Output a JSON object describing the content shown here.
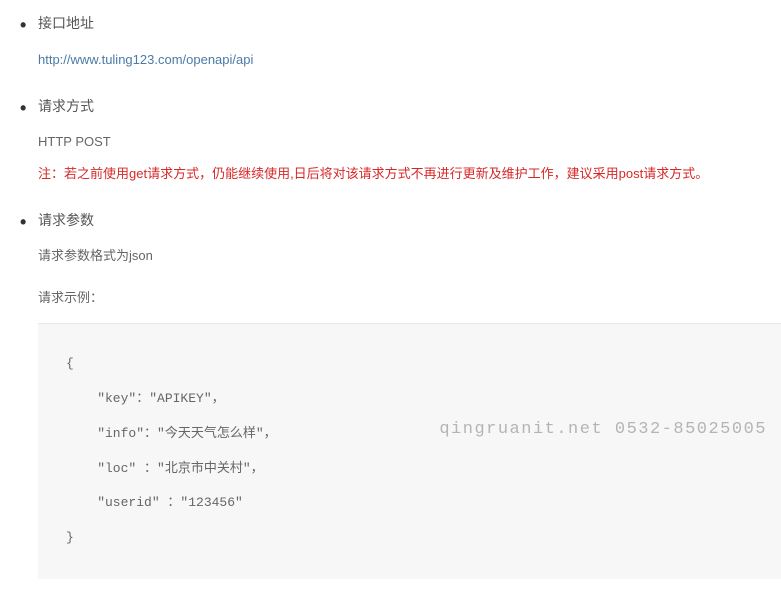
{
  "sections": {
    "address": {
      "title": "接口地址",
      "url": "http://www.tuling123.com/openapi/api"
    },
    "method": {
      "title": "请求方式",
      "value": "HTTP POST",
      "note": "注：若之前使用get请求方式，仍能继续使用,日后将对该请求方式不再进行更新及维护工作，建议采用post请求方式。"
    },
    "params": {
      "title": "请求参数",
      "format_text": "请求参数格式为json",
      "example_label": "请求示例：",
      "code_lines": [
        "{",
        "    \"key\"：\"APIKEY\"，",
        "    \"info\"：\"今天天气怎么样\"，",
        "    \"loc\" ：\"北京市中关村\"，",
        "    \"userid\" ：\"123456\"",
        "}"
      ]
    }
  },
  "watermark": "qingruanit.net 0532-85025005"
}
